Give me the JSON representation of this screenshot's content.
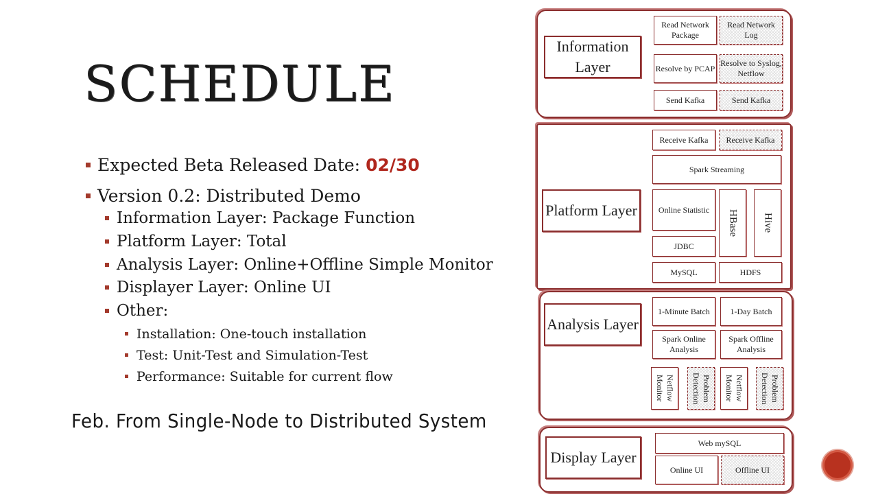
{
  "slide": {
    "title": "SCHEDULE",
    "bullets": {
      "beta_prefix": "Expected Beta Released Date: ",
      "beta_date": "02/30",
      "version": "Version 0.2: Distributed Demo",
      "information": "Information Layer: Package Function",
      "platform": "Platform Layer: Total",
      "analysis": "Analysis Layer: Online+Offline Simple Monitor",
      "displayer": "Displayer Layer: Online UI",
      "other": "Other:",
      "installation": "Installation: One-touch installation",
      "test": "Test: Unit-Test and Simulation-Test",
      "performance": "Performance: Suitable for current flow"
    },
    "footer": "Feb. From Single-Node to Distributed System"
  },
  "diagram": {
    "information": {
      "label": "Information Layer",
      "read_network_package": "Read Network Package",
      "read_network_log": "Read Network Log",
      "resolve_pcap": "Resolve by PCAP",
      "resolve_syslog": "Resolve to Syslog, Netflow",
      "send_kafka": "Send Kafka",
      "send_kafka_2": "Send Kafka"
    },
    "platform": {
      "label": "Platform Layer",
      "receive_kafka": "Receive Kafka",
      "receive_kafka_2": "Receive Kafka",
      "spark_streaming": "Spark Streaming",
      "online_statistic": "Online Statistic",
      "hbase": "HBase",
      "hive": "Hive",
      "jdbc": "JDBC",
      "mysql": "MySQL",
      "hdfs": "HDFS"
    },
    "analysis": {
      "label": "Analysis Layer",
      "minute_batch": "1-Minute Batch",
      "day_batch": "1-Day Batch",
      "spark_online": "Spark Online Analysis",
      "spark_offline": "Spark Offline Analysis",
      "netflow_monitor_1": "Netflow Monitor",
      "problem_detection_1": "Problem Detection",
      "netflow_monitor_2": "Netflow Monitor",
      "problem_detection_2": "Problem Detection"
    },
    "display": {
      "label": "Display Layer",
      "web_mysql": "Web mySQL",
      "online_ui": "Online UI",
      "offline_ui": "Offline UI"
    }
  },
  "colors": {
    "accent": "#b0261c",
    "box_border": "#8b2e2e",
    "nav_circle": "#b8321f"
  }
}
